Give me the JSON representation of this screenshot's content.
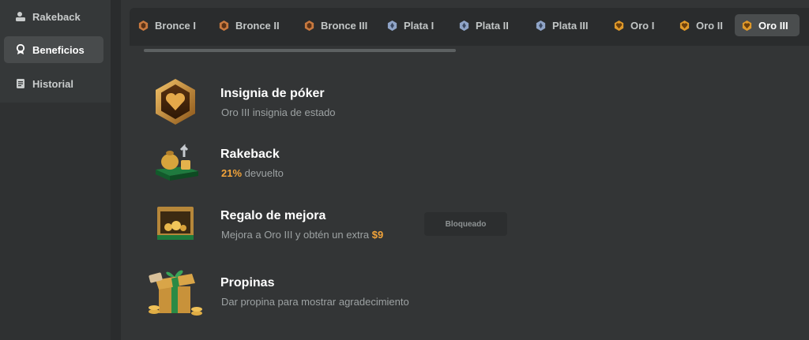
{
  "sidebar": {
    "items": [
      {
        "label": "Rakeback",
        "icon": "rakeback-icon",
        "active": false
      },
      {
        "label": "Beneficios",
        "icon": "award-icon",
        "active": true
      },
      {
        "label": "Historial",
        "icon": "document-icon",
        "active": false
      }
    ]
  },
  "tabs": [
    {
      "label": "Bronce I",
      "tier": "bronze"
    },
    {
      "label": "Bronce II",
      "tier": "bronze"
    },
    {
      "label": "Bronce III",
      "tier": "bronze"
    },
    {
      "label": "Plata I",
      "tier": "silver"
    },
    {
      "label": "Plata II",
      "tier": "silver"
    },
    {
      "label": "Plata III",
      "tier": "silver"
    },
    {
      "label": "Oro I",
      "tier": "gold"
    },
    {
      "label": "Oro II",
      "tier": "gold"
    },
    {
      "label": "Oro III",
      "tier": "gold",
      "active": true
    }
  ],
  "benefits": {
    "badge": {
      "title": "Insignia de póker",
      "desc": "Oro III insignia de estado"
    },
    "rakeback": {
      "title": "Rakeback",
      "percent": "21%",
      "desc_suffix": " devuelto"
    },
    "upgrade": {
      "title": "Regalo de mejora",
      "desc_prefix": "Mejora a Oro III y obtén un extra ",
      "amount": "$9",
      "status": "Bloqueado"
    },
    "tips": {
      "title": "Propinas",
      "desc": "Dar propina para mostrar agradecimiento"
    }
  },
  "colors": {
    "accent_orange": "#f3a43a",
    "bronze": "#c8793f",
    "silver": "#8fa4c7",
    "gold": "#e09a2a"
  }
}
